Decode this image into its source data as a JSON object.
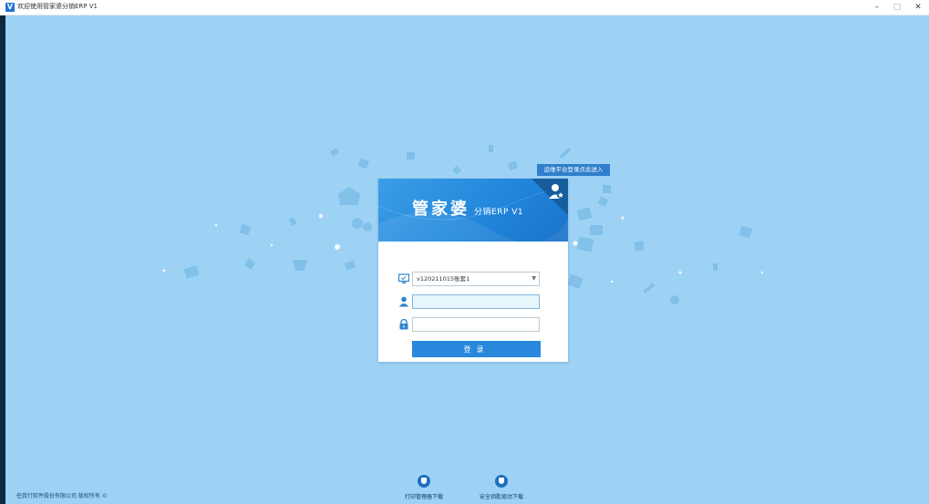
{
  "window": {
    "icon_letter": "V",
    "title": "欢迎使用管家婆分销ERP V1",
    "min_glyph": "–",
    "max_glyph": "□",
    "close_glyph": "✕"
  },
  "cloud_badge": "运维平台登录点此进入",
  "brand": {
    "name_cn": "管家婆",
    "sub": "分销ERP V1"
  },
  "login": {
    "account_set": "v120211015账套1",
    "username": "",
    "password": "",
    "login_label": "登录"
  },
  "footer": {
    "copyright": "任我行软件股份有限公司 版权所有 ©",
    "downloads": [
      {
        "label": "打印管理器下载",
        "icon": "shield-icon"
      },
      {
        "label": "安全钥匙驱动下载",
        "icon": "shield-icon"
      }
    ]
  },
  "colors": {
    "background": "#9ed2f5",
    "brand_blue": "#2287dc",
    "button": "#2788dc"
  }
}
